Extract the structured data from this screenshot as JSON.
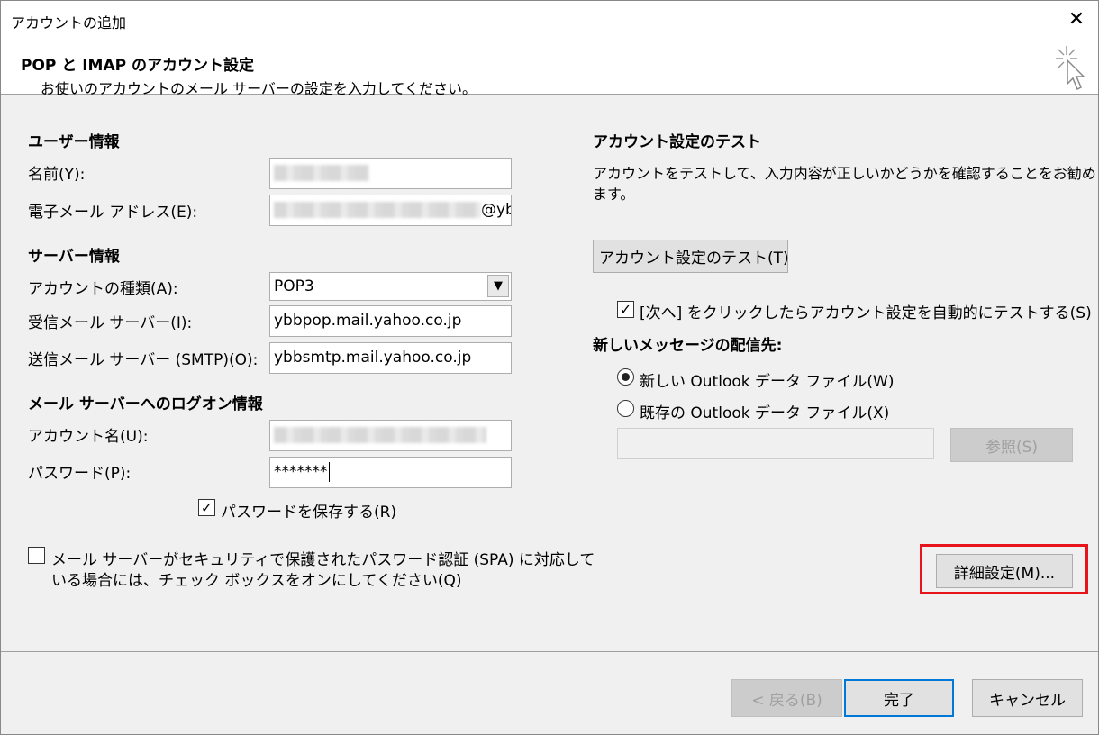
{
  "window": {
    "title": "アカウントの追加",
    "close_glyph": "✕"
  },
  "header": {
    "title": "POP と IMAP のアカウント設定",
    "subtitle": "お使いのアカウントのメール サーバーの設定を入力してください。"
  },
  "user_info": {
    "heading": "ユーザー情報",
    "name_label": "名前(Y):",
    "email_label": "電子メール アドレス(E):",
    "email_suffix": "@yb"
  },
  "server_info": {
    "heading": "サーバー情報",
    "account_type_label": "アカウントの種類(A):",
    "account_type_value": "POP3",
    "incoming_label": "受信メール サーバー(I):",
    "incoming_value": "ybbpop.mail.yahoo.co.jp",
    "outgoing_label": "送信メール サーバー (SMTP)(O):",
    "outgoing_value": "ybbsmtp.mail.yahoo.co.jp"
  },
  "logon_info": {
    "heading": "メール サーバーへのログオン情報",
    "account_name_label": "アカウント名(U):",
    "password_label": "パスワード(P):",
    "password_value": "*******",
    "save_password_label": "パスワードを保存する(R)",
    "save_password_checked": true,
    "spa_label_line1": "メール サーバーがセキュリティで保護されたパスワード認証 (SPA) に対応して",
    "spa_label_line2": "いる場合には、チェック ボックスをオンにしてください(Q)",
    "spa_checked": false
  },
  "test": {
    "heading": "アカウント設定のテスト",
    "description_line1": "アカウントをテストして、入力内容が正しいかどうかを確認することをお勧めし",
    "description_line2": "ます。",
    "test_button": "アカウント設定のテスト(T)",
    "auto_test_label": "[次へ] をクリックしたらアカウント設定を自動的にテストする(S)",
    "auto_test_checked": true
  },
  "delivery": {
    "heading": "新しいメッセージの配信先:",
    "new_file_label": "新しい Outlook データ ファイル(W)",
    "existing_file_label": "既存の Outlook データ ファイル(X)",
    "selected": "new",
    "browse_button": "参照(S)"
  },
  "advanced_button": "詳細設定(M)...",
  "footer": {
    "back_button": "< 戻る(B)",
    "finish_button": "完了",
    "cancel_button": "キャンセル"
  },
  "colors": {
    "highlight_box": "#e8141b",
    "default_button_border": "#0078d7"
  },
  "check_glyph": "✓"
}
